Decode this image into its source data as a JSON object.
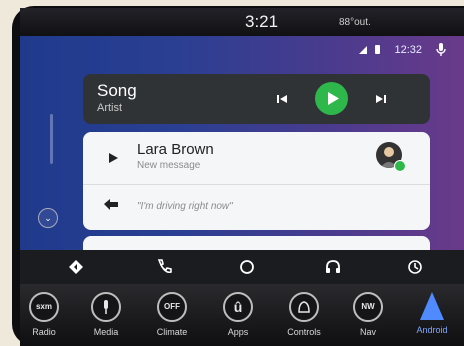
{
  "topbar": {
    "time": "3:21",
    "outside_temp": "88°out."
  },
  "status": {
    "time": "12:32",
    "icons": [
      "signal-icon",
      "battery-icon",
      "mic-icon"
    ]
  },
  "media": {
    "song": "Song",
    "artist": "Artist",
    "controls": [
      "previous-icon",
      "play-icon",
      "next-icon"
    ]
  },
  "message": {
    "sender": "Lara Brown",
    "subtitle": "New message",
    "reply": "\"I'm driving right now\""
  },
  "nav": {
    "icons": [
      "navigation-icon",
      "phone-icon",
      "home-icon",
      "headphones-icon",
      "recent-icon"
    ]
  },
  "bottom_bar": {
    "buttons": [
      {
        "label": "Radio",
        "badge": "sxm"
      },
      {
        "label": "Media",
        "badge": ""
      },
      {
        "label": "Climate",
        "badge": "OFF"
      },
      {
        "label": "Apps",
        "badge": "û"
      },
      {
        "label": "Controls",
        "badge": ""
      },
      {
        "label": "Nav",
        "badge": "NW"
      },
      {
        "label": "Android",
        "badge": ""
      }
    ]
  },
  "colors": {
    "accent_green": "#2eb84b",
    "android_blue": "#4f8bff"
  }
}
